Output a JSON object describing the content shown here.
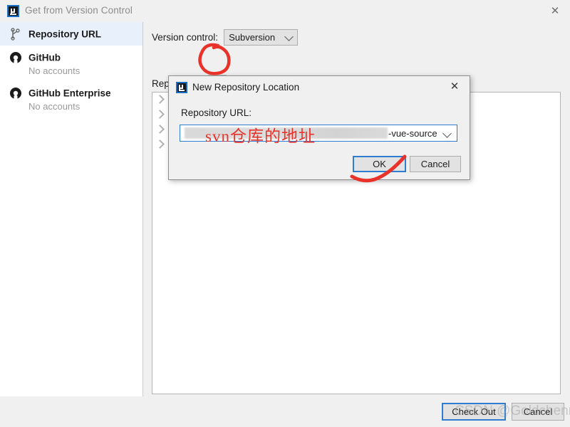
{
  "window": {
    "title": "Get from Version Control",
    "icon": "intellij-logo-icon",
    "close_label": "✕"
  },
  "sidebar": {
    "items": [
      {
        "label": "Repository URL",
        "sub": "",
        "icon": "branch-icon",
        "selected": true
      },
      {
        "label": "GitHub",
        "sub": "No accounts",
        "icon": "github-icon",
        "selected": false
      },
      {
        "label": "GitHub Enterprise",
        "sub": "No accounts",
        "icon": "github-icon",
        "selected": false
      }
    ]
  },
  "main": {
    "version_control_label": "Version control:",
    "version_control_value": "Subversion",
    "version_control_options": [
      "Subversion"
    ],
    "repositories_label": "Repositories",
    "toolbar": [
      {
        "name": "add-repository-button",
        "icon": "plus-icon",
        "glyph": "+",
        "highlighted": true
      },
      {
        "name": "edit-repository-button",
        "icon": "pencil-icon",
        "glyph": "",
        "highlighted": false
      },
      {
        "name": "remove-repository-button",
        "icon": "minus-icon",
        "glyph": "−",
        "highlighted": false
      },
      {
        "name": "copy-repository-button",
        "icon": "document-copy-icon",
        "glyph": "",
        "highlighted": false
      },
      {
        "name": "refresh-button",
        "icon": "refresh-icon",
        "glyph": "",
        "highlighted": false
      },
      {
        "name": "collapse-all-button",
        "icon": "collapse-all-icon",
        "glyph": "",
        "highlighted": false
      }
    ],
    "tree_rows": [
      {
        "chevron": "chevron-right-icon",
        "text": ""
      },
      {
        "chevron": "chevron-right-icon",
        "text": ""
      },
      {
        "chevron": "chevron-right-icon",
        "text": ""
      },
      {
        "chevron": "chevron-right-icon",
        "text": ""
      }
    ]
  },
  "footer": {
    "checkout_label": "Check Out",
    "cancel_label": "Cancel"
  },
  "dialog": {
    "title": "New Repository Location",
    "icon": "intellij-logo-icon",
    "close_label": "✕",
    "url_label": "Repository URL:",
    "url_value_visible": "-vue-source",
    "url_value_redacted": true,
    "ok_label": "OK",
    "cancel_label": "Cancel"
  },
  "annotations": {
    "red_text": "svn仓库的地址",
    "red_color": "#e8322a",
    "circle_target": "add-repository-button",
    "check_target": "ok-button"
  },
  "watermark": {
    "text": "CSDN @Goldchenn"
  }
}
